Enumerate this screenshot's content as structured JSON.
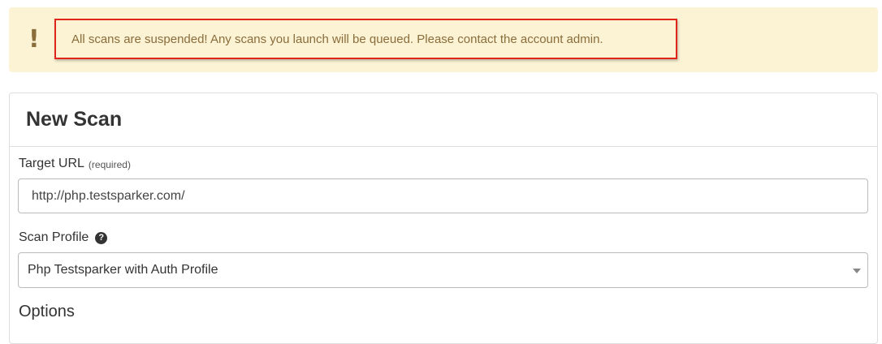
{
  "alert": {
    "icon": "!",
    "message": "All scans are suspended! Any scans you launch will be queued. Please contact the account admin."
  },
  "panel": {
    "title": "New Scan",
    "target_url": {
      "label": "Target URL",
      "required_note": "(required)",
      "value": "http://php.testsparker.com/"
    },
    "scan_profile": {
      "label": "Scan Profile",
      "help_glyph": "?",
      "selected": "Php Testsparker with Auth Profile"
    },
    "options_title": "Options"
  }
}
